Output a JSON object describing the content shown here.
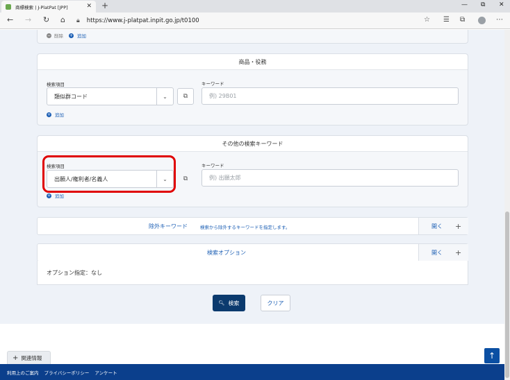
{
  "browser": {
    "tab_title": "商標検索 | J-PlatPat [JPP]",
    "tab_close": "✕",
    "new_tab": "+",
    "url": "https://www.j-platpat.inpit.go.jp/t0100",
    "window_minimize": "—",
    "window_maximize": "⧉",
    "window_close": "✕"
  },
  "top_panel": {
    "delete_label": "削除",
    "add_label": "追加"
  },
  "goods_services": {
    "header": "商品・役務",
    "field_label": "検索項目",
    "selected": "類似群コード",
    "keyword_label": "キーワード",
    "keyword_placeholder": "例) 29B01",
    "add_label": "追加"
  },
  "other_keywords": {
    "header": "その他の検索キーワード",
    "field_label": "検索項目",
    "selected": "出願人/権利者/名義人",
    "keyword_label": "キーワード",
    "keyword_placeholder": "例) 出願太郎",
    "add_label": "追加"
  },
  "exclude_keywords": {
    "title": "除外キーワード",
    "description": "検索から除外するキーワードを指定します。",
    "open_label": "開く",
    "plus": "+"
  },
  "search_options": {
    "title": "検索オプション",
    "open_label": "開く",
    "plus": "+",
    "summary": "オプション指定：なし"
  },
  "actions": {
    "search_label": "検索",
    "clear_label": "クリア"
  },
  "related_info": {
    "label": "関連情報"
  },
  "footer": {
    "links": [
      "利用上のご案内",
      "プライバシーポリシー",
      "アンケート"
    ]
  },
  "colors": {
    "highlight": "#e00000",
    "primary": "#0b3a6e",
    "link": "#1c5fb4",
    "footer": "#0b3f8c"
  }
}
